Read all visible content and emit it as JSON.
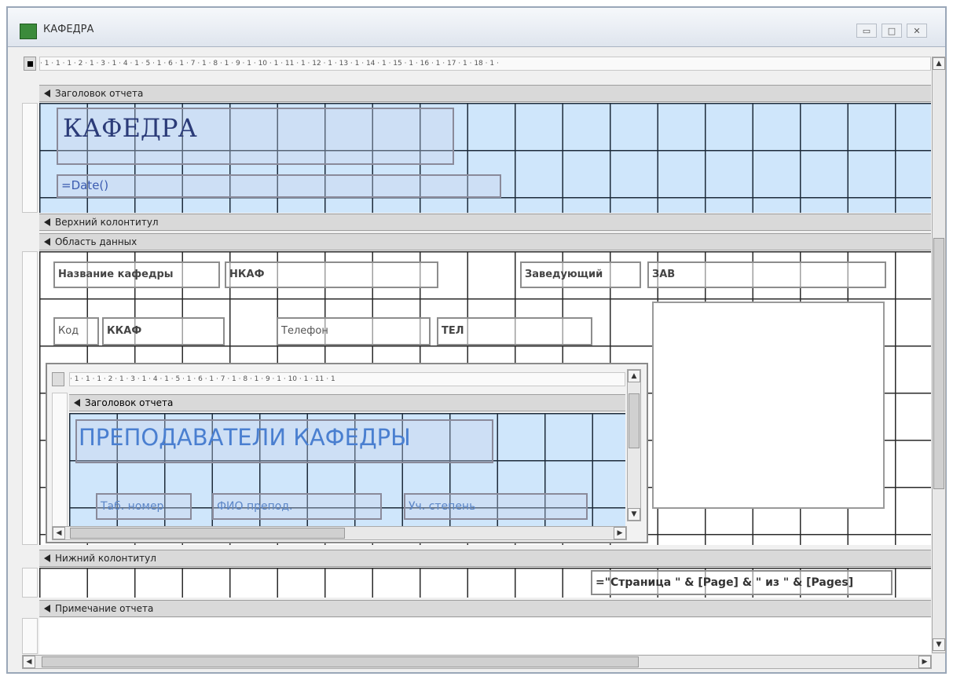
{
  "window": {
    "title": "КАФЕДРА",
    "buttons": {
      "minimize": "▭",
      "maximize": "□",
      "close": "✕"
    }
  },
  "ruler": {
    "marks": "· 1 · 1 · 1 · 2 · 1 · 3 · 1 · 4 · 1 · 5 · 1 · 6 · 1 · 7 · 1 · 8 · 1 · 9 · 1 · 10 · 1 · 11 · 1 · 12 · 1 · 13 · 1 · 14 · 1 · 15 · 1 · 16 · 1 · 17 · 1 · 18 · 1 ·"
  },
  "sections": {
    "report_header": "Заголовок отчета",
    "page_header": "Верхний колонтитул",
    "detail": "Область данных",
    "page_footer": "Нижний колонтитул",
    "report_footer": "Примечание отчета"
  },
  "report_header": {
    "title": "КАФЕДРА",
    "date_expr": "=Date()"
  },
  "detail": {
    "label_name": "Название кафедры",
    "field_name": "НКАФ",
    "label_head": "Заведующий",
    "field_head": "ЗАВ",
    "label_code": "Код",
    "field_code": "ККАФ",
    "label_phone": "Телефон",
    "field_phone": "ТЕЛ"
  },
  "subreport": {
    "ruler": "· 1 · 1 · 1 · 2 · 1 · 3 · 1 · 4 · 1 · 5 · 1 · 6 · 1 · 7 · 1 · 8 · 1 · 9 · 1 · 10 · 1 · 11 · 1",
    "section": "Заголовок отчета",
    "title": "ПРЕПОДАВАТЕЛИ КАФЕДРЫ",
    "col1": "Таб. номер",
    "col2": "ФИО препод.",
    "col3": "Уч. степень"
  },
  "page_footer": {
    "page_expr": "=\"Страница \" & [Page] & \" из \" & [Pages]"
  }
}
